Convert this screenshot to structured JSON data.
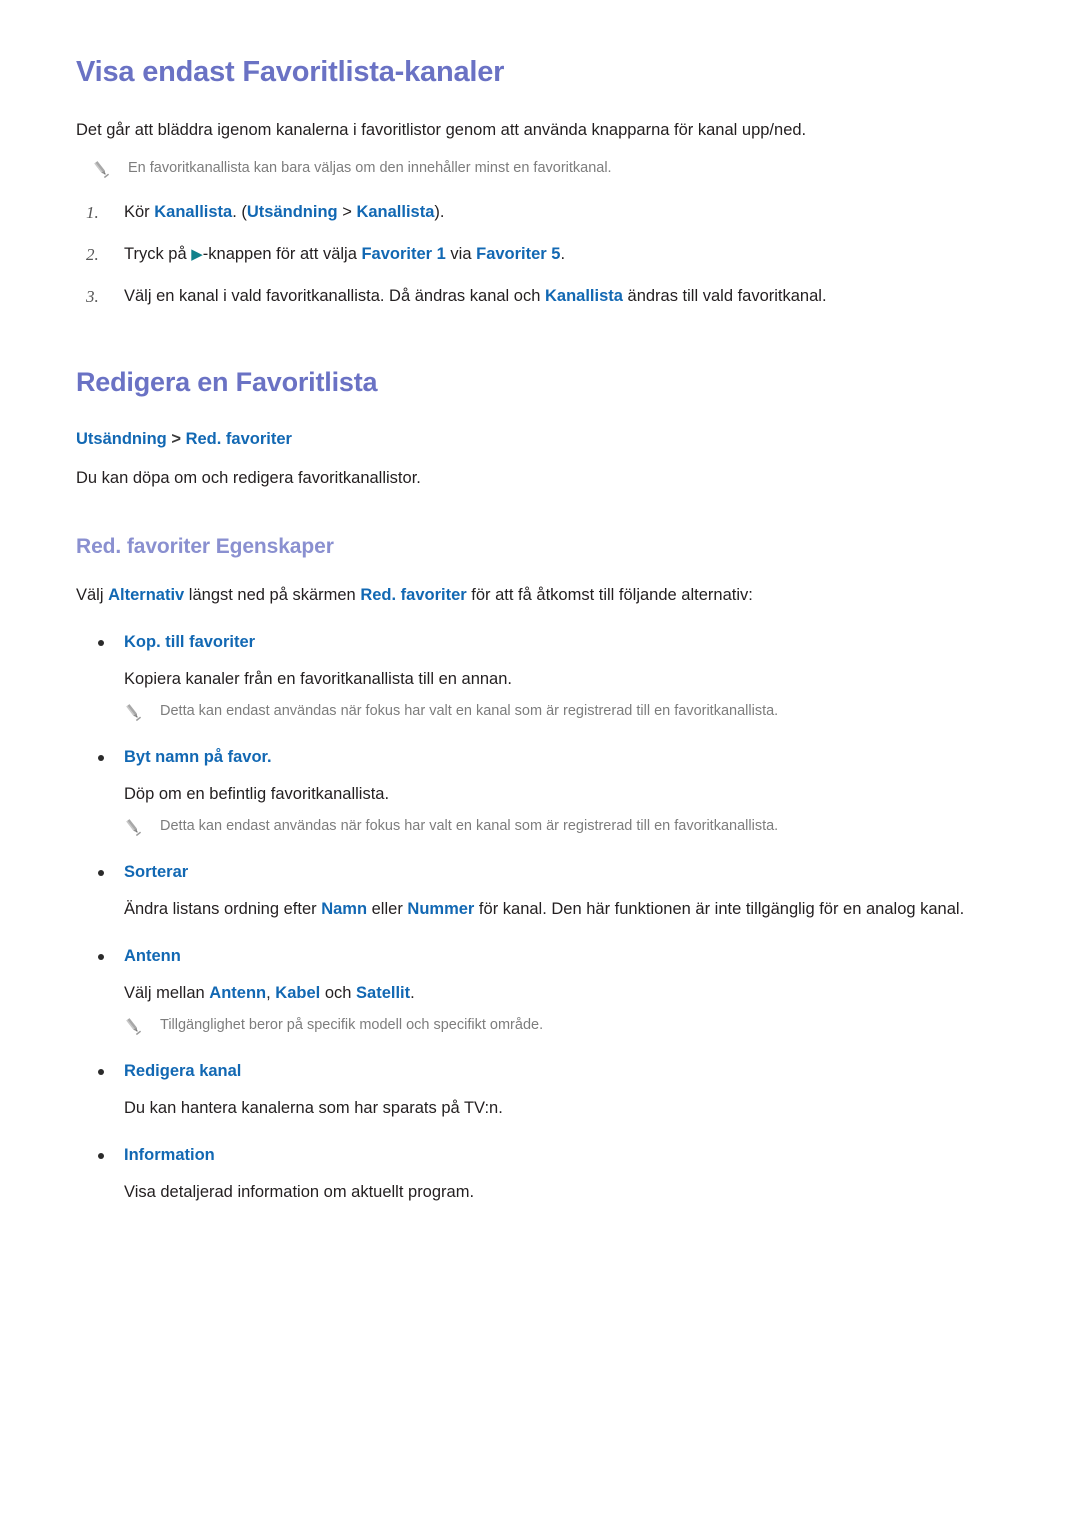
{
  "colors": {
    "heading_primary": "#6a72c4",
    "heading_tertiary": "#8a90d0",
    "keyword_blue": "#1268b3",
    "note_gray": "#7d7d7d",
    "arrow_teal": "#10828c",
    "body_text": "#231f20"
  },
  "section1": {
    "title": "Visa endast Favoritlista-kanaler",
    "intro": "Det går att bläddra igenom kanalerna i favoritlistor genom att använda knapparna för kanal upp/ned.",
    "note": "En favoritkanallista kan bara väljas om den innehåller minst en favoritkanal.",
    "steps": [
      {
        "number": "1.",
        "parts": [
          {
            "text": "Kör ",
            "style": "plain"
          },
          {
            "text": "Kanallista",
            "style": "keyword"
          },
          {
            "text": ". (",
            "style": "plain"
          },
          {
            "text": "Utsändning",
            "style": "keyword"
          },
          {
            "text": " > ",
            "style": "plain"
          },
          {
            "text": "Kanallista",
            "style": "keyword"
          },
          {
            "text": ").",
            "style": "plain"
          }
        ]
      },
      {
        "number": "2.",
        "parts": [
          {
            "text": "Tryck på ",
            "style": "plain"
          },
          {
            "text": "▶",
            "style": "arrow"
          },
          {
            "text": "-knappen för att välja ",
            "style": "plain"
          },
          {
            "text": "Favoriter 1",
            "style": "keyword"
          },
          {
            "text": " via ",
            "style": "plain"
          },
          {
            "text": "Favoriter 5",
            "style": "keyword"
          },
          {
            "text": ".",
            "style": "plain"
          }
        ]
      },
      {
        "number": "3.",
        "parts": [
          {
            "text": "Välj en kanal i vald favoritkanallista. Då ändras kanal och ",
            "style": "plain"
          },
          {
            "text": "Kanallista",
            "style": "keyword"
          },
          {
            "text": " ändras till vald favoritkanal.",
            "style": "plain"
          }
        ]
      }
    ]
  },
  "section2": {
    "title": "Redigera en Favoritlista",
    "breadcrumb": {
      "first": "Utsändning",
      "separator": ">",
      "second": "Red. favoriter"
    },
    "description": "Du kan döpa om och redigera favoritkanallistor.",
    "subsection": {
      "title": "Red. favoriter Egenskaper",
      "intro_parts": [
        {
          "text": "Välj ",
          "style": "plain"
        },
        {
          "text": "Alternativ",
          "style": "keyword"
        },
        {
          "text": " längst ned på skärmen ",
          "style": "plain"
        },
        {
          "text": "Red. favoriter",
          "style": "keyword"
        },
        {
          "text": " för att få åtkomst till följande alternativ:",
          "style": "plain"
        }
      ],
      "options": [
        {
          "title": "Kop. till favoriter",
          "desc_parts": [
            {
              "text": "Kopiera kanaler från en favoritkanallista till en annan.",
              "style": "plain"
            }
          ],
          "note": "Detta kan endast användas när fokus har valt en kanal som är registrerad till en favoritkanallista."
        },
        {
          "title": "Byt namn på favor.",
          "desc_parts": [
            {
              "text": "Döp om en befintlig favoritkanallista.",
              "style": "plain"
            }
          ],
          "note": "Detta kan endast användas när fokus har valt en kanal som är registrerad till en favoritkanallista."
        },
        {
          "title": "Sorterar",
          "desc_parts": [
            {
              "text": "Ändra listans ordning efter ",
              "style": "plain"
            },
            {
              "text": "Namn",
              "style": "keyword"
            },
            {
              "text": " eller ",
              "style": "plain"
            },
            {
              "text": "Nummer",
              "style": "keyword"
            },
            {
              "text": " för kanal. Den här funktionen är inte tillgänglig för en analog kanal.",
              "style": "plain"
            }
          ],
          "note": null
        },
        {
          "title": "Antenn",
          "desc_parts": [
            {
              "text": "Välj mellan ",
              "style": "plain"
            },
            {
              "text": "Antenn",
              "style": "keyword"
            },
            {
              "text": ", ",
              "style": "plain"
            },
            {
              "text": "Kabel",
              "style": "keyword"
            },
            {
              "text": " och ",
              "style": "plain"
            },
            {
              "text": "Satellit",
              "style": "keyword"
            },
            {
              "text": ".",
              "style": "plain"
            }
          ],
          "note": "Tillgänglighet beror på specifik modell och specifikt område."
        },
        {
          "title": "Redigera kanal",
          "desc_parts": [
            {
              "text": "Du kan hantera kanalerna som har sparats på TV:n.",
              "style": "plain"
            }
          ],
          "note": null
        },
        {
          "title": "Information",
          "desc_parts": [
            {
              "text": "Visa detaljerad information om aktuellt program.",
              "style": "plain"
            }
          ],
          "note": null
        }
      ]
    }
  },
  "icons": {
    "note_icon": "pencil-icon",
    "step_arrow": "right-triangle-icon",
    "bullet": "dot-bullet-icon"
  }
}
